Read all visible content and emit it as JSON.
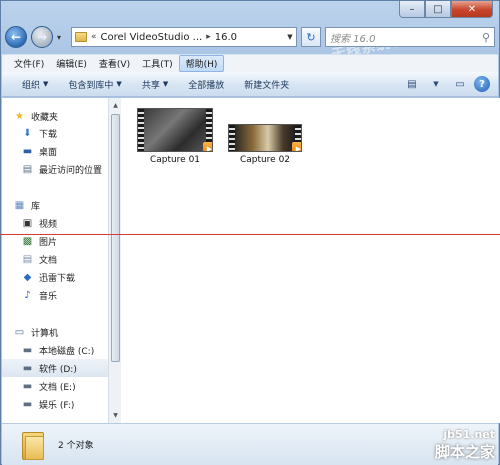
{
  "window": {
    "caption_min": "–",
    "caption_max": "□",
    "caption_close": "✕"
  },
  "address": {
    "prefix": "«",
    "segment1": "Corel VideoStudio ...",
    "segment2": "16.0",
    "separator": "▸",
    "search_placeholder": "搜索 16.0"
  },
  "menu": {
    "items": [
      "文件(F)",
      "编辑(E)",
      "查看(V)",
      "工具(T)",
      "帮助(H)"
    ]
  },
  "toolbar": {
    "organize": "组织",
    "include": "包含到库中",
    "share": "共享",
    "play_all": "全部播放",
    "new_folder": "新建文件夹"
  },
  "nav": {
    "favorites": "收藏夹",
    "downloads": "下载",
    "desktop": "桌面",
    "recent": "最近访问的位置",
    "libraries": "库",
    "videos": "视频",
    "pictures": "图片",
    "documents": "文档",
    "thunder": "迅雷下载",
    "music": "音乐",
    "computer": "计算机",
    "drive_c": "本地磁盘 (C:)",
    "drive_d": "软件 (D:)",
    "drive_e": "文档 (E:)",
    "drive_f": "娱乐 (F:)"
  },
  "files": [
    {
      "name": "Capture 01"
    },
    {
      "name": "Capture 02"
    }
  ],
  "status": {
    "count": "2 个对象"
  },
  "watermark": {
    "site": "jb51.net",
    "name": "脚本之家"
  }
}
